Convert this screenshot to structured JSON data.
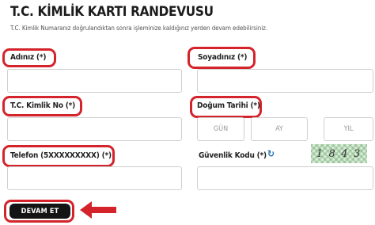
{
  "header": {
    "title": "T.C. KİMLİK KARTI RANDEVUSU",
    "subtitle": "T.C. Kimlik Numaranız doğrulandıktan sonra işleminize kaldığınız yerden devam edebilirsiniz."
  },
  "form": {
    "first_name_label": "Adınız (*)",
    "last_name_label": "Soyadınız (*)",
    "tc_no_label": "T.C. Kimlik No (*)",
    "birth_date_label": "Doğum Tarihi (*)",
    "day_placeholder": "GÜN",
    "month_placeholder": "AY",
    "year_placeholder": "YIL",
    "phone_label": "Telefon (5XXXXXXXXX) (*)",
    "security_code_label": "Güvenlik Kodu (*)",
    "captcha_digits": [
      "1",
      "8",
      "4",
      "3"
    ],
    "submit_label": "DEVAM ET"
  },
  "colors": {
    "highlight": "#d4232b",
    "button_bg": "#141414",
    "refresh_icon": "#1f6fb5"
  },
  "icons": {
    "refresh": "refresh-icon",
    "arrow": "arrow-left-icon"
  }
}
